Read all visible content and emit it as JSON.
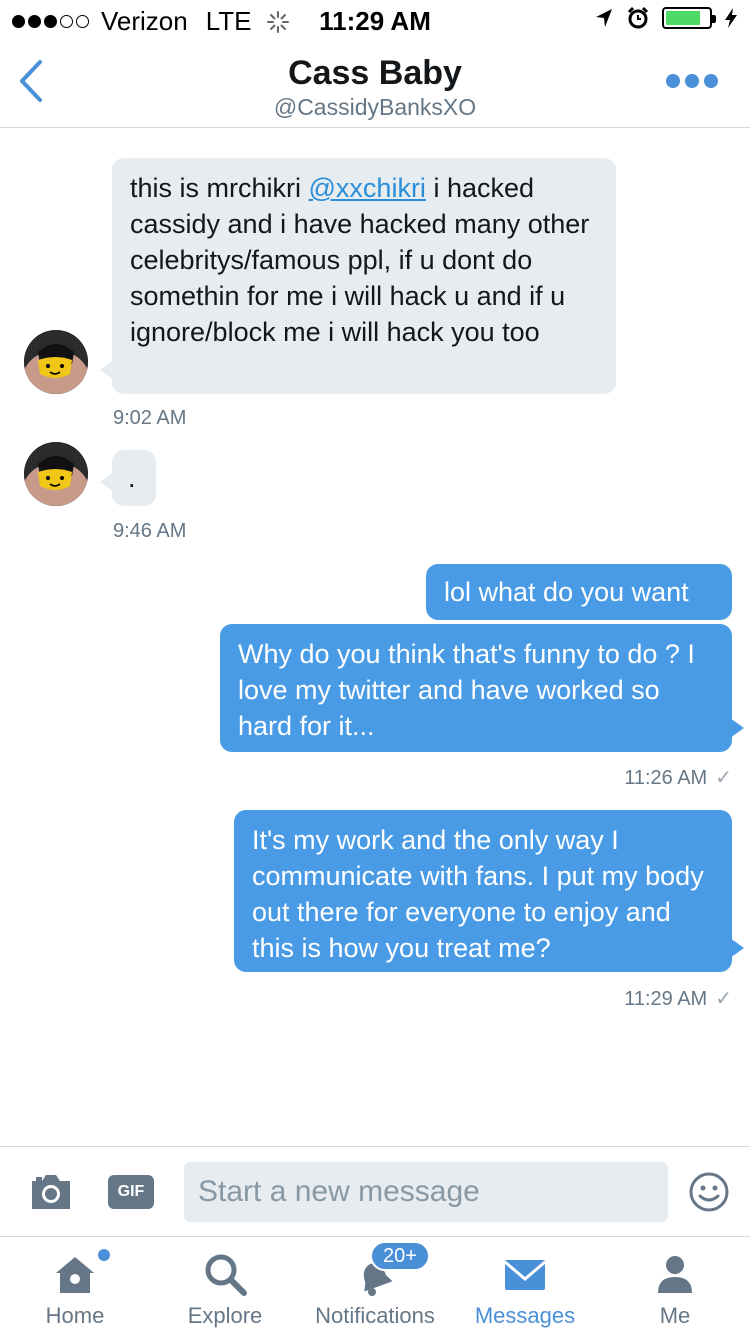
{
  "status_bar": {
    "carrier": "Verizon",
    "network": "LTE",
    "time": "11:29 AM"
  },
  "header": {
    "title": "Cass Baby",
    "handle": "@CassidyBanksXO",
    "back_icon": "chevron-left-icon",
    "more_icon": "more-dots-icon"
  },
  "messages": [
    {
      "direction": "incoming",
      "text_before": "this is mrchikri ",
      "mention": "@xxchikri",
      "text_after": " i hacked cassidy and i have hacked many other celebritys/famous ppl, if u dont do somethin for me i will hack u and if u ignore/block me i will hack you too",
      "timestamp": "9:02 AM"
    },
    {
      "direction": "incoming",
      "text": ".",
      "timestamp": "9:46 AM"
    },
    {
      "direction": "outgoing",
      "text": "lol what do you want"
    },
    {
      "direction": "outgoing",
      "text": "Why do you think that's funny to do ? I love my twitter and have worked so hard for it...",
      "timestamp": "11:26 AM"
    },
    {
      "direction": "outgoing",
      "text": "It's my work and the only way I communicate with fans. I put my body out there for everyone to enjoy and this is how you treat me?",
      "timestamp": "11:29 AM"
    }
  ],
  "composer": {
    "placeholder": "Start a new message",
    "gif_label": "GIF",
    "camera_icon": "camera-icon",
    "emoji_icon": "smiley-icon"
  },
  "tabbar": {
    "items": [
      {
        "label": "Home",
        "icon": "home-icon"
      },
      {
        "label": "Explore",
        "icon": "search-icon"
      },
      {
        "label": "Notifications",
        "icon": "bell-icon",
        "badge": "20+"
      },
      {
        "label": "Messages",
        "icon": "envelope-icon",
        "active": true
      },
      {
        "label": "Me",
        "icon": "person-icon"
      }
    ]
  },
  "colors": {
    "accent": "#4a90d9",
    "outgoing_bubble": "#4a9be6",
    "incoming_bubble": "#e6ecf0"
  }
}
